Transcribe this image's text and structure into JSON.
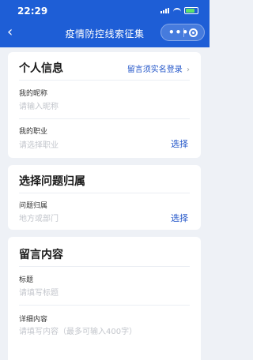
{
  "status_bar": {
    "time": "22:29"
  },
  "navbar": {
    "back": "‹",
    "title": "疫情防控线索征集",
    "more": "•••"
  },
  "personal": {
    "title": "个人信息",
    "real_name_link": "留言须实名登录",
    "chevron": "›",
    "nickname_label": "我的昵称",
    "nickname_placeholder": "请输入昵称",
    "job_label": "我的职业",
    "job_placeholder": "请选择职业",
    "job_select": "选择"
  },
  "category": {
    "title": "选择问题归属",
    "label": "问题归属",
    "placeholder": "地方或部门",
    "select": "选择"
  },
  "message": {
    "title": "留言内容",
    "subject_label": "标题",
    "subject_placeholder": "请填写标题",
    "detail_label": "详细内容",
    "detail_placeholder": "请填写内容（最多可输入400字）"
  },
  "colors": {
    "brand_blue": "#1e5ed6",
    "link_blue": "#2356c9",
    "background": "#eef1f6"
  }
}
